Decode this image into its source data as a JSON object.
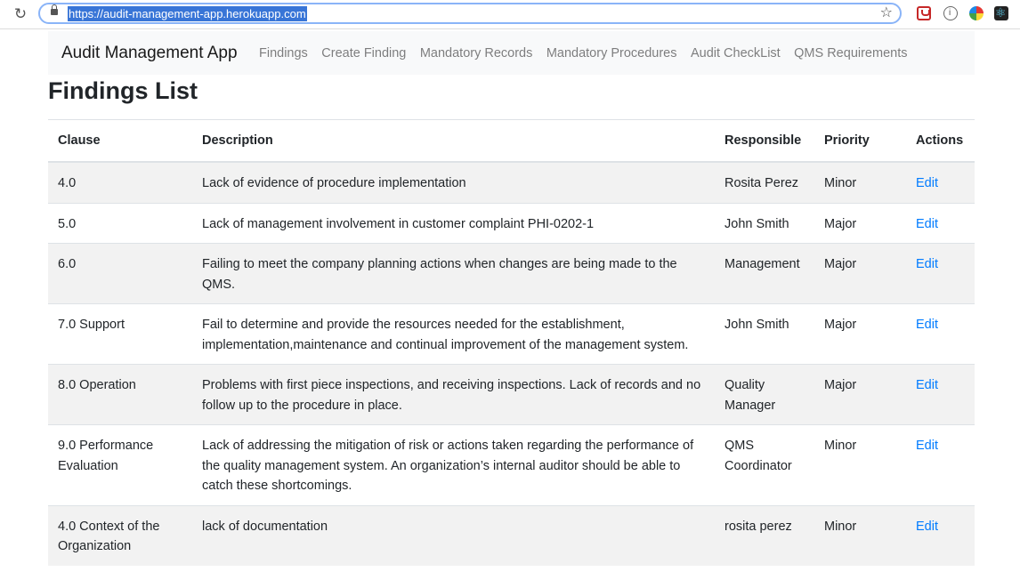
{
  "browser": {
    "url": "https://audit-management-app.herokuapp.com"
  },
  "navbar": {
    "brand": "Audit Management App",
    "links": [
      "Findings",
      "Create Finding",
      "Mandatory Records",
      "Mandatory Procedures",
      "Audit CheckList",
      "QMS Requirements"
    ]
  },
  "page": {
    "title": "Findings List"
  },
  "table": {
    "headers": [
      "Clause",
      "Description",
      "Responsible",
      "Priority",
      "Actions"
    ],
    "rows": [
      {
        "clause": "4.0",
        "description": "Lack of evidence of procedure implementation",
        "responsible": "Rosita Perez",
        "priority": "Minor",
        "action": "Edit"
      },
      {
        "clause": "5.0",
        "description": "Lack of management involvement in customer complaint PHI-0202-1",
        "responsible": "John Smith",
        "priority": "Major",
        "action": "Edit"
      },
      {
        "clause": "6.0",
        "description": "Failing to meet the company planning actions when changes are being made to the QMS.",
        "responsible": "Management",
        "priority": "Major",
        "action": "Edit"
      },
      {
        "clause": "7.0 Support",
        "description": "Fail to determine and provide the resources needed for the establishment, implementation,maintenance and continual improvement of the management system.",
        "responsible": "John Smith",
        "priority": "Major",
        "action": "Edit"
      },
      {
        "clause": "8.0 Operation",
        "description": "Problems with first piece inspections, and receiving inspections. Lack of records and no follow up to the procedure in place.",
        "responsible": "Quality Manager",
        "priority": "Major",
        "action": "Edit"
      },
      {
        "clause": "9.0 Performance Evaluation",
        "description": "Lack of addressing the mitigation of risk or actions taken regarding the performance of the quality management system. An organization’s internal auditor should be able to catch these shortcomings.",
        "responsible": "QMS Coordinator",
        "priority": "Minor",
        "action": "Edit"
      },
      {
        "clause": "4.0 Context of the Organization",
        "description": "lack of documentation",
        "responsible": "rosita perez",
        "priority": "Minor",
        "action": "Edit"
      }
    ]
  },
  "colors": {
    "link": "#007bff",
    "row_stripe": "#f2f2f2",
    "navbar_bg": "#f8f9fa"
  }
}
